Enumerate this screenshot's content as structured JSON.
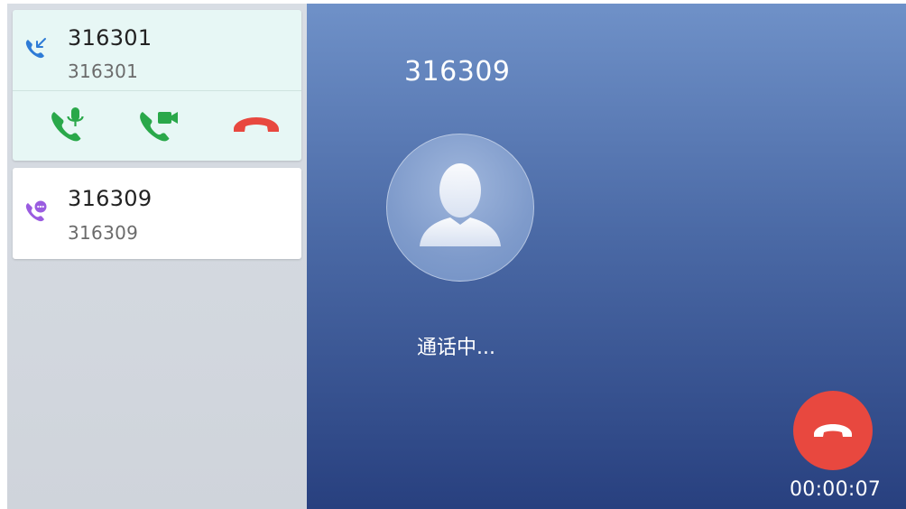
{
  "call_list": [
    {
      "name": "316301",
      "number": "316301",
      "state": "incoming",
      "icon": "incoming-call-icon",
      "actions": [
        {
          "name": "answer-audio-button",
          "icon": "phone-mic-icon",
          "color": "#2aa84a"
        },
        {
          "name": "answer-video-button",
          "icon": "phone-video-icon",
          "color": "#2aa84a"
        },
        {
          "name": "reject-button",
          "icon": "hangup-icon",
          "color": "#e8483f"
        }
      ]
    },
    {
      "name": "316309",
      "number": "316309",
      "state": "active",
      "icon": "talking-call-icon"
    }
  ],
  "main": {
    "caller_number": "316309",
    "avatar_icon": "person-icon",
    "status": "通话中...",
    "hangup_icon": "hangup-icon",
    "timer": "00:00:07"
  },
  "colors": {
    "accent_blue": "#2e7bd6",
    "answer_green": "#2aa84a",
    "hangup_red": "#e8483f",
    "talking_purple": "#9a5ce0",
    "incoming_card_bg": "#e7f7f5"
  }
}
